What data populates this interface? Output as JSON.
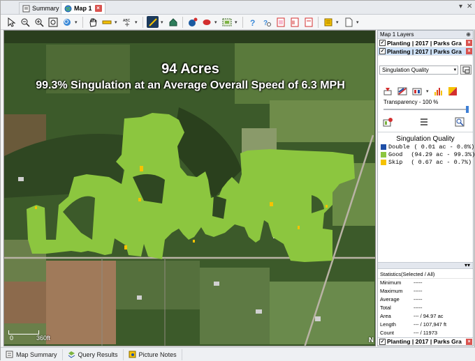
{
  "tabs": [
    {
      "label": "Summary",
      "active": false
    },
    {
      "label": "Map 1",
      "active": true
    }
  ],
  "map": {
    "headline": "94 Acres",
    "subheadline": "99.3% Singulation at an Average Overall Speed of 6.3 MPH",
    "scale_zero": "0",
    "scale_label": "360ft",
    "north_label": "N"
  },
  "panel": {
    "header": "Map 1 Layers",
    "layers": [
      {
        "label": "Planting | 2017 | Parks Gra",
        "checked": true,
        "selected": false
      },
      {
        "label": "Planting | 2017 | Parks Gra",
        "checked": true,
        "selected": true
      }
    ],
    "attribute": "Singulation Quality",
    "transparency": "Transparency - 100 %",
    "transparency_value": 1.0,
    "legend_title": "Singulation Quality",
    "legend": [
      {
        "label": "Double",
        "detail": "( 0.01 ac - 0.0%)",
        "color": "#1f4fa8"
      },
      {
        "label": "Good",
        "detail": "(94.29 ac - 99.3%)",
        "color": "#8cc63f"
      },
      {
        "label": "Skip",
        "detail": "( 0.67 ac - 0.7%)",
        "color": "#f5c200"
      }
    ],
    "stats_title": "Statistics(Selected / All)",
    "stats": [
      {
        "k": "Minimum",
        "v": "-----"
      },
      {
        "k": "Maximum",
        "v": "-----"
      },
      {
        "k": "Average",
        "v": "-----"
      },
      {
        "k": "Total",
        "v": "-----"
      },
      {
        "k": "Area",
        "v": "--- / 94.97 ac"
      },
      {
        "k": "Length",
        "v": "--- / 107,947 ft"
      },
      {
        "k": "Count",
        "v": "--- / 11973"
      }
    ],
    "bottom_layer": "Planting | 2017 | Parks Gra"
  },
  "bottom_tabs": [
    {
      "label": "Map Summary"
    },
    {
      "label": "Query Results"
    },
    {
      "label": "Picture Notes"
    }
  ],
  "colors": {
    "field_green": "#8cc63f",
    "skip_yellow": "#f5c200",
    "double_blue": "#1f4fa8"
  }
}
